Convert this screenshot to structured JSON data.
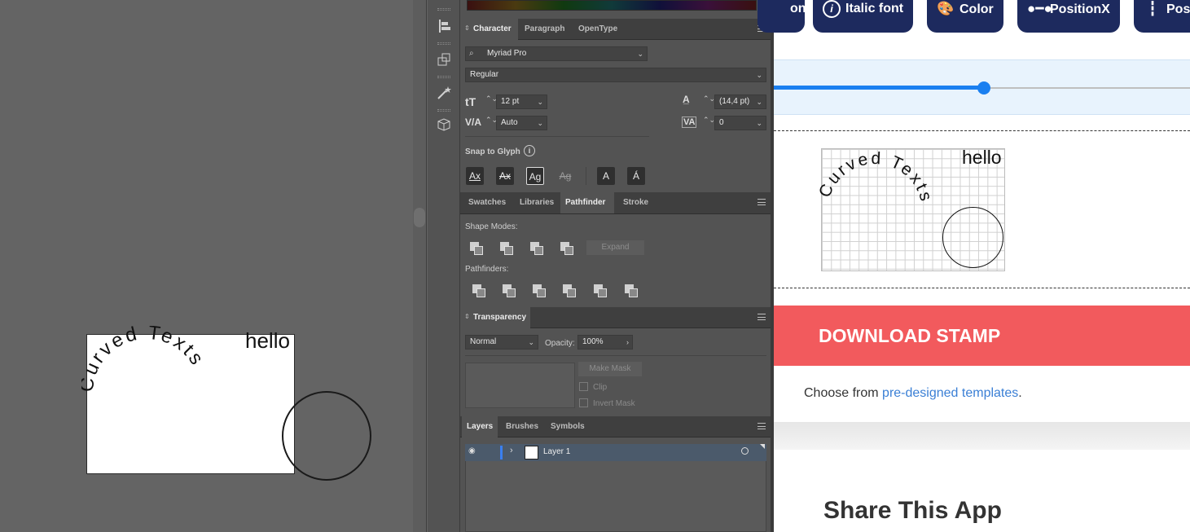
{
  "canvas": {
    "curved_text": "Curved Texts",
    "hello_text": "hello"
  },
  "character_panel": {
    "tabs": [
      "Character",
      "Paragraph",
      "OpenType"
    ],
    "font_family": "Myriad Pro",
    "font_style": "Regular",
    "font_size": "12 pt",
    "leading": "(14,4 pt)",
    "kerning": "Auto",
    "tracking": "0",
    "snap_to_glyph_label": "Snap to Glyph",
    "snap_glyphs": [
      "Ax",
      "Ax",
      "Ag",
      "Ag",
      "A",
      "Á"
    ]
  },
  "pathfinder_panel": {
    "tabs": [
      "Swatches",
      "Libraries",
      "Pathfinder",
      "Stroke"
    ],
    "shape_modes_label": "Shape Modes:",
    "expand_label": "Expand",
    "pathfinders_label": "Pathfinders:"
  },
  "transparency_panel": {
    "tab": "Transparency",
    "blend_mode": "Normal",
    "opacity_label": "Opacity:",
    "opacity_value": "100%",
    "make_mask_label": "Make Mask",
    "clip_label": "Clip",
    "invert_mask_label": "Invert Mask"
  },
  "layers_panel": {
    "tabs": [
      "Layers",
      "Brushes",
      "Symbols"
    ],
    "layer_name": "Layer 1"
  },
  "web": {
    "chips": [
      {
        "label": "ont",
        "icon": "font-icon"
      },
      {
        "label": "Italic font",
        "icon": "info-icon"
      },
      {
        "label": "Color",
        "icon": "palette-icon"
      },
      {
        "label": "PositionX",
        "icon": "position-x-icon"
      },
      {
        "label": "Pos",
        "icon": "position-y-icon"
      }
    ],
    "preview_curved_text": "Curved Texts",
    "preview_hello_text": "hello",
    "download_label": "DOWNLOAD STAMP",
    "choose_prefix": "Choose from ",
    "choose_link": "pre-designed templates",
    "choose_suffix": ".",
    "share_title": "Share This App",
    "colors": {
      "chip_bg": "#1d2a5e",
      "download_bg": "#f25a5d",
      "slider_accent": "#1a7ff0",
      "link": "#3a7fd5"
    }
  }
}
